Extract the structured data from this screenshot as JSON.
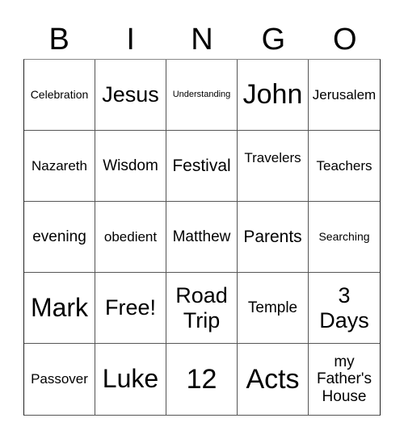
{
  "header": {
    "letters": [
      "B",
      "I",
      "N",
      "G",
      "O"
    ]
  },
  "board": {
    "rows": [
      [
        "Celebration",
        "Jesus",
        "Understanding",
        "John",
        "Jerusalem"
      ],
      [
        "Nazareth",
        "Wisdom",
        "Festival",
        "Travelers",
        "Teachers"
      ],
      [
        "evening",
        "obedient",
        "Matthew",
        "Parents",
        "Searching"
      ],
      [
        "Mark",
        "Free!",
        "Road\nTrip",
        "Temple",
        "3\nDays"
      ],
      [
        "Passover",
        "Luke",
        "12",
        "Acts",
        "my\nFather's\nHouse"
      ]
    ],
    "free_space": "Free!"
  }
}
